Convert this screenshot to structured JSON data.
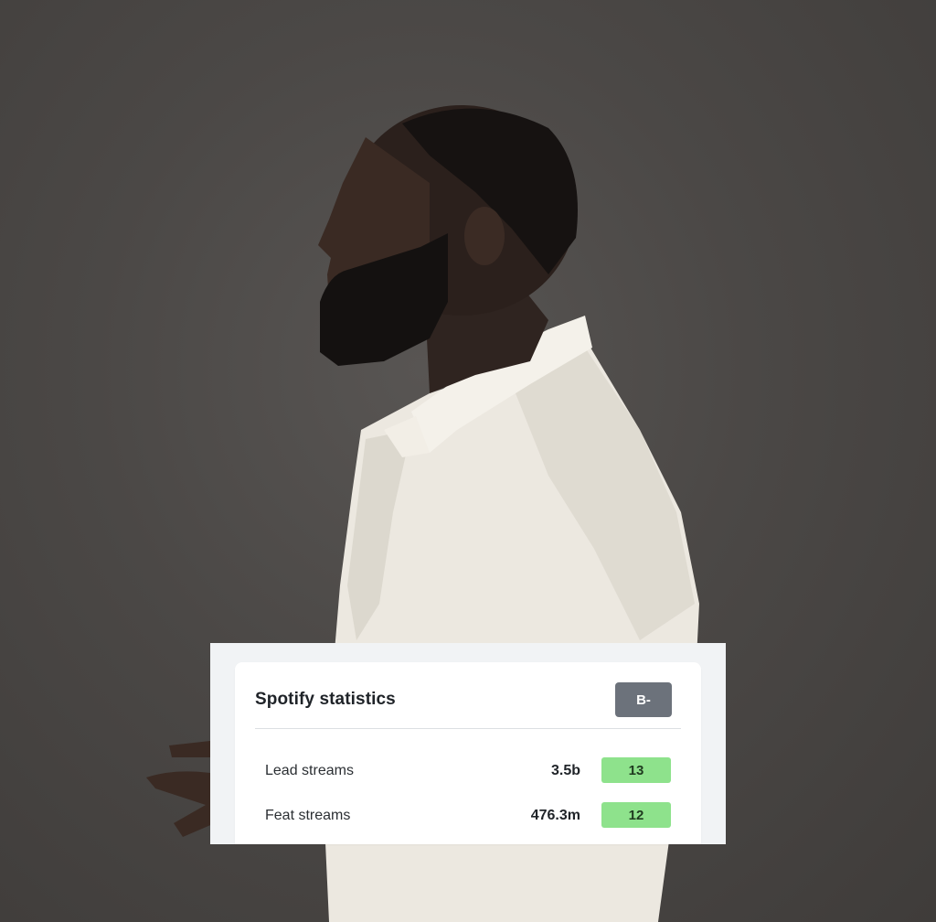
{
  "spotify_card": {
    "title": "Spotify statistics",
    "grade": "B-",
    "rows": [
      {
        "label": "Lead streams",
        "value": "3.5b",
        "rank": "13"
      },
      {
        "label": "Feat streams",
        "value": "476.3m",
        "rank": "12"
      }
    ]
  },
  "colors": {
    "background": "#4a4745",
    "grade_badge": "#6c727b",
    "rank_badge": "#8ee28c",
    "card": "#ffffff"
  }
}
